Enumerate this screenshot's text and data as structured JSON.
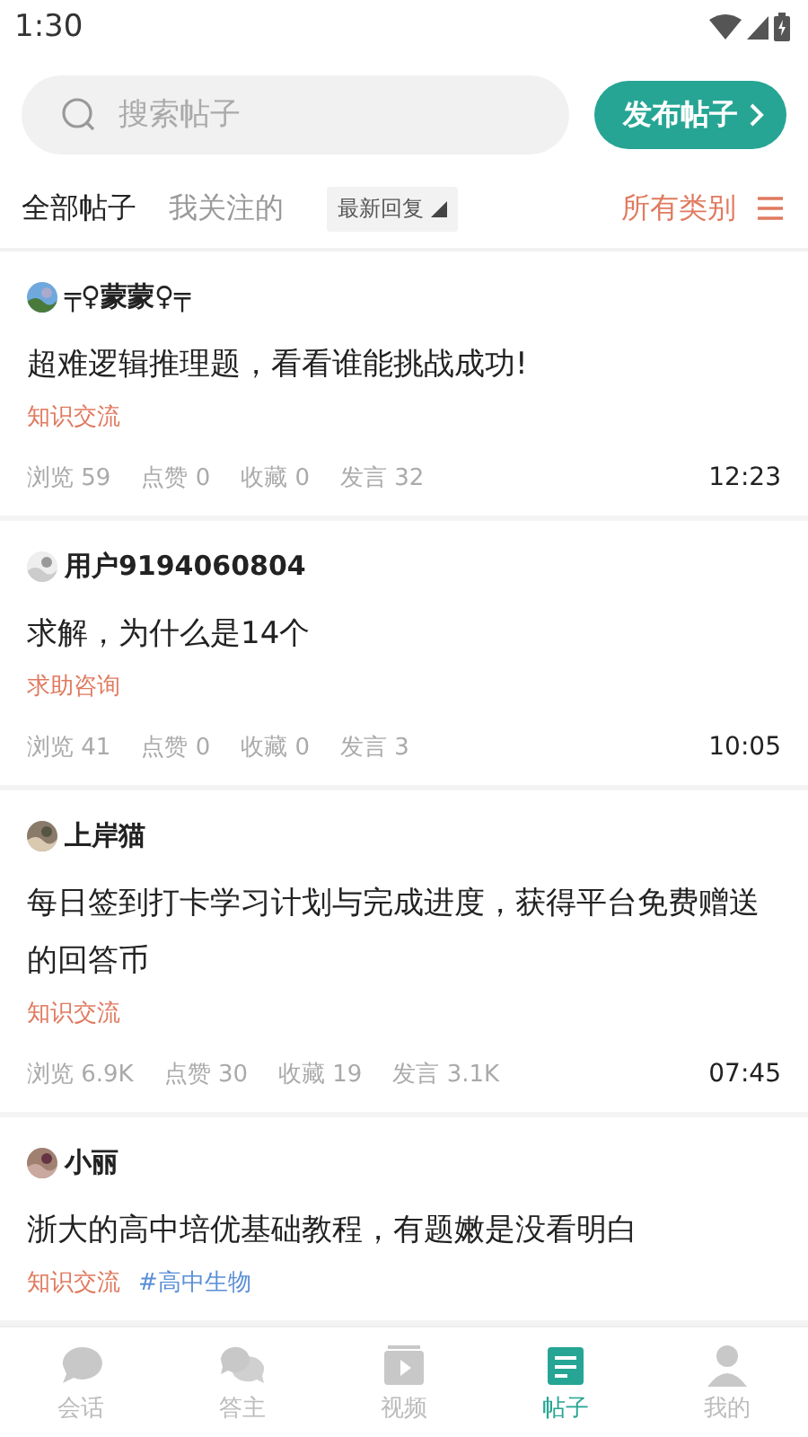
{
  "status_bar": {
    "time": "1:30"
  },
  "search": {
    "placeholder": "搜索帖子"
  },
  "post_button": {
    "label": "发布帖子"
  },
  "filter_tabs": [
    {
      "label": "全部帖子",
      "selected": true
    },
    {
      "label": "我关注的",
      "selected": false
    }
  ],
  "sort": {
    "label": "最新回复"
  },
  "category": {
    "label": "所有类别"
  },
  "posts": [
    {
      "author": "╤♀蒙蒙♀╤",
      "title": "超难逻辑推理题，看看谁能挑战成功!",
      "tags": [
        "知识交流"
      ],
      "stats": [
        {
          "label": "浏览",
          "value": "59"
        },
        {
          "label": "点赞",
          "value": "0"
        },
        {
          "label": "收藏",
          "value": "0"
        },
        {
          "label": "发言",
          "value": "32"
        }
      ],
      "time": "12:23"
    },
    {
      "author": "用户9194060804",
      "title": "求解，为什么是14个",
      "tags": [
        "求助咨询"
      ],
      "stats": [
        {
          "label": "浏览",
          "value": "41"
        },
        {
          "label": "点赞",
          "value": "0"
        },
        {
          "label": "收藏",
          "value": "0"
        },
        {
          "label": "发言",
          "value": "3"
        }
      ],
      "time": "10:05"
    },
    {
      "author": "上岸猫",
      "title": "每日签到打卡学习计划与完成进度，获得平台免费赠送的回答币",
      "tags": [
        "知识交流"
      ],
      "stats": [
        {
          "label": "浏览",
          "value": "6.9K"
        },
        {
          "label": "点赞",
          "value": "30"
        },
        {
          "label": "收藏",
          "value": "19"
        },
        {
          "label": "发言",
          "value": "3.1K"
        }
      ],
      "time": "07:45"
    },
    {
      "author": "小丽",
      "title": "浙大的高中培优基础教程，有题嫩是没看明白",
      "tags": [
        "知识交流",
        "#高中生物"
      ]
    }
  ],
  "bottom_nav": [
    {
      "label": "会话",
      "kind": "chat",
      "selected": false
    },
    {
      "label": "答主",
      "kind": "chats",
      "selected": false
    },
    {
      "label": "视频",
      "kind": "video",
      "selected": false
    },
    {
      "label": "帖子",
      "kind": "posts",
      "selected": true
    },
    {
      "label": "我的",
      "kind": "person",
      "selected": false
    }
  ]
}
